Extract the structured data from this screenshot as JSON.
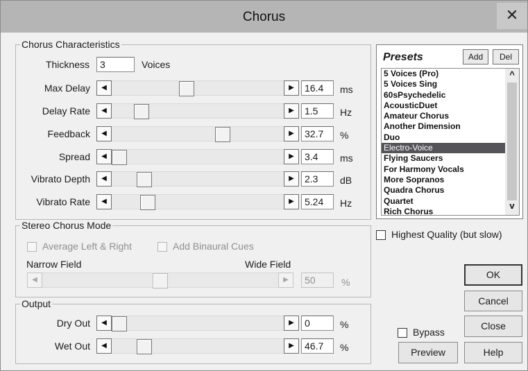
{
  "window": {
    "title": "Chorus",
    "close_glyph": "✕"
  },
  "characteristics": {
    "legend": "Chorus Characteristics",
    "thickness": {
      "label": "Thickness",
      "value": "3",
      "unit": "Voices"
    },
    "sliders": [
      {
        "label": "Max Delay",
        "value": "16.4",
        "unit": "ms",
        "position": 0.43
      },
      {
        "label": "Delay Rate",
        "value": "1.5",
        "unit": "Hz",
        "position": 0.14
      },
      {
        "label": "Feedback",
        "value": "32.7",
        "unit": "%",
        "position": 0.66
      },
      {
        "label": "Spread",
        "value": "3.4",
        "unit": "ms",
        "position": 0.0
      },
      {
        "label": "Vibrato Depth",
        "value": "2.3",
        "unit": "dB",
        "position": 0.16
      },
      {
        "label": "Vibrato Rate",
        "value": "5.24",
        "unit": "Hz",
        "position": 0.18
      }
    ]
  },
  "stereo": {
    "legend": "Stereo Chorus Mode",
    "average_label": "Average Left & Right",
    "binaural_label": "Add Binaural Cues",
    "narrow_label": "Narrow Field",
    "wide_label": "Wide Field",
    "value": "50",
    "unit": "%",
    "position": 0.5
  },
  "output": {
    "legend": "Output",
    "sliders": [
      {
        "label": "Dry Out",
        "value": "0",
        "unit": "%",
        "position": 0.0
      },
      {
        "label": "Wet Out",
        "value": "46.7",
        "unit": "%",
        "position": 0.16
      }
    ]
  },
  "presets": {
    "title": "Presets",
    "add_label": "Add",
    "del_label": "Del",
    "items": [
      "5 Voices (Pro)",
      "5 Voices Sing",
      "60sPsychedelic",
      "AcousticDuet",
      "Amateur Chorus",
      "Another Dimension",
      "Duo",
      "Electro-Voice",
      "Flying Saucers",
      "For Harmony Vocals",
      "More Sopranos",
      "Quadra Chorus",
      "Quartet",
      "Rich Chorus"
    ],
    "selected_index": 7,
    "scroll_up_glyph": "^",
    "scroll_down_glyph": "v"
  },
  "highest_quality_label": "Highest Quality (but slow)",
  "buttons": {
    "ok": "OK",
    "cancel": "Cancel",
    "close": "Close",
    "help": "Help",
    "preview": "Preview",
    "bypass": "Bypass"
  },
  "glyphs": {
    "left": "◀",
    "right": "▶"
  },
  "colors": {
    "title_bar": "#b5b5b5",
    "selected_row": "#555559",
    "dialog_bg": "#f0f0f0"
  }
}
